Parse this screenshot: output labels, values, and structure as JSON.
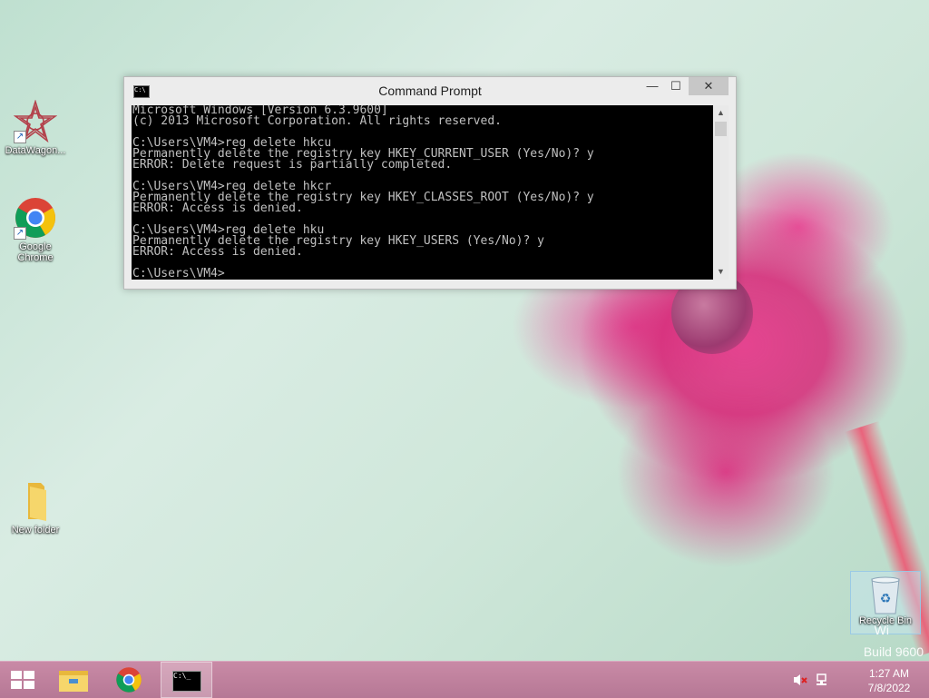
{
  "desktop": {
    "icons": [
      {
        "label": "DataWagon..."
      },
      {
        "label": "Google Chrome"
      },
      {
        "label": "New folder"
      },
      {
        "label": "Recycle Bin"
      }
    ]
  },
  "window": {
    "title": "Command Prompt",
    "console_lines": [
      "Microsoft Windows [Version 6.3.9600]",
      "(c) 2013 Microsoft Corporation. All rights reserved.",
      "",
      "C:\\Users\\VM4>reg delete hkcu",
      "Permanently delete the registry key HKEY_CURRENT_USER (Yes/No)? y",
      "ERROR: Delete request is partially completed.",
      "",
      "C:\\Users\\VM4>reg delete hkcr",
      "Permanently delete the registry key HKEY_CLASSES_ROOT (Yes/No)? y",
      "ERROR: Access is denied.",
      "",
      "C:\\Users\\VM4>reg delete hku",
      "Permanently delete the registry key HKEY_USERS (Yes/No)? y",
      "ERROR: Access is denied.",
      "",
      "C:\\Users\\VM4>"
    ],
    "buttons": {
      "minimize": "—",
      "maximize": "☐",
      "close": "✕"
    }
  },
  "watermark": {
    "line1": "Wi",
    "line2": "Build 9600"
  },
  "taskbar": {
    "clock_time": "1:27 AM",
    "clock_date": "7/8/2022"
  },
  "icons": {
    "start": "windows-logo-icon",
    "explorer": "file-explorer-icon",
    "chrome": "chrome-icon",
    "cmd": "command-prompt-icon",
    "volume": "volume-muted-icon",
    "network": "network-icon"
  }
}
